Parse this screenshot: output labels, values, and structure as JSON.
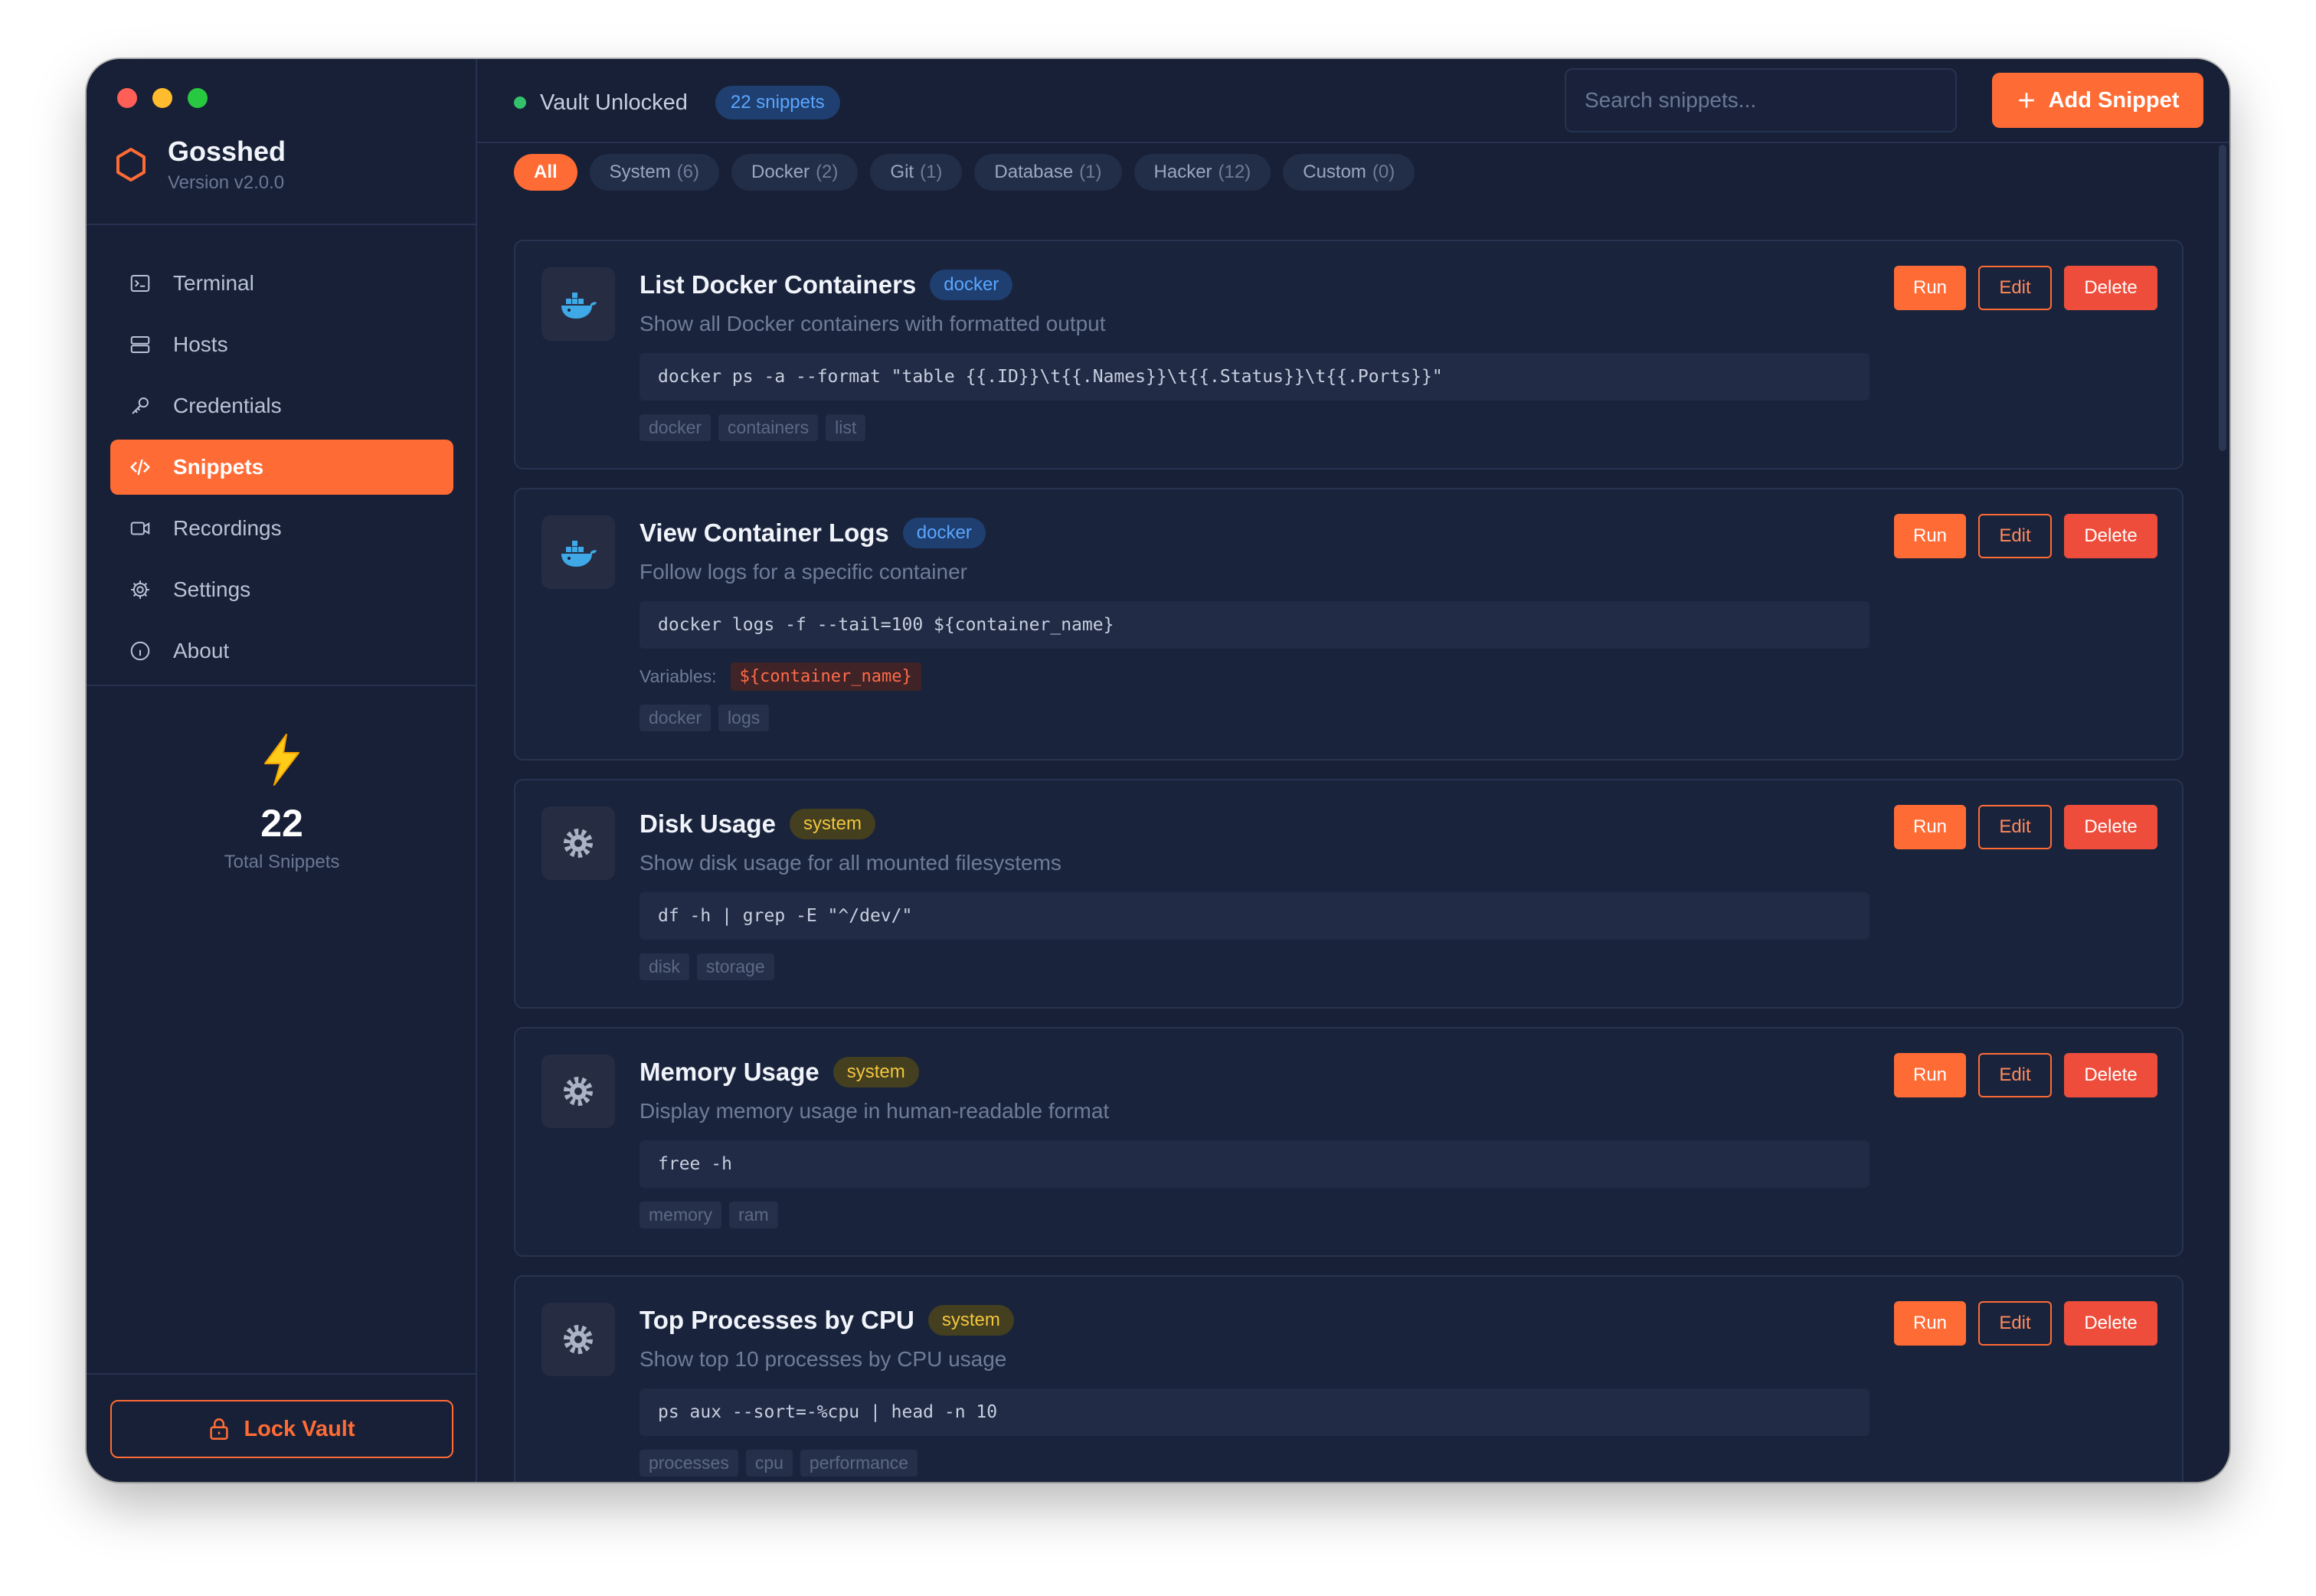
{
  "app": {
    "name": "Gosshed",
    "version": "Version v2.0.0"
  },
  "colors": {
    "accent": "#ff6b35",
    "background": "#172036",
    "success": "#33c26b",
    "danger": "#ee4d3b"
  },
  "nav": [
    {
      "label": "Terminal",
      "icon": "terminal-icon",
      "active": false
    },
    {
      "label": "Hosts",
      "icon": "server-icon",
      "active": false
    },
    {
      "label": "Credentials",
      "icon": "key-icon",
      "active": false
    },
    {
      "label": "Snippets",
      "icon": "code-icon",
      "active": true
    },
    {
      "label": "Recordings",
      "icon": "video-icon",
      "active": false
    },
    {
      "label": "Settings",
      "icon": "gear-icon",
      "active": false
    },
    {
      "label": "About",
      "icon": "info-icon",
      "active": false
    }
  ],
  "stats": {
    "icon": "lightning-icon",
    "value": "22",
    "label": "Total Snippets"
  },
  "lock_button": "Lock Vault",
  "header": {
    "status": "Vault Unlocked",
    "count_badge": "22 snippets",
    "search_placeholder": "Search snippets...",
    "add_button": "Add Snippet"
  },
  "filters": [
    {
      "label": "All",
      "count": "",
      "active": true
    },
    {
      "label": "System",
      "count": "(6)",
      "active": false
    },
    {
      "label": "Docker",
      "count": "(2)",
      "active": false
    },
    {
      "label": "Git",
      "count": "(1)",
      "active": false
    },
    {
      "label": "Database",
      "count": "(1)",
      "active": false
    },
    {
      "label": "Hacker",
      "count": "(12)",
      "active": false
    },
    {
      "label": "Custom",
      "count": "(0)",
      "active": false
    }
  ],
  "actions": {
    "run": "Run",
    "edit": "Edit",
    "delete": "Delete"
  },
  "variables_label": "Variables:",
  "snippets": [
    {
      "icon": "whale-icon",
      "title": "List Docker Containers",
      "category": "docker",
      "description": "Show all Docker containers with formatted output",
      "command": "docker ps -a --format \"table {{.ID}}\\t{{.Names}}\\t{{.Status}}\\t{{.Ports}}\"",
      "variables": [],
      "tags": [
        "docker",
        "containers",
        "list"
      ]
    },
    {
      "icon": "whale-icon",
      "title": "View Container Logs",
      "category": "docker",
      "description": "Follow logs for a specific container",
      "command": "docker logs -f --tail=100 ${container_name}",
      "variables": [
        "${container_name}"
      ],
      "tags": [
        "docker",
        "logs"
      ]
    },
    {
      "icon": "gear-icon",
      "title": "Disk Usage",
      "category": "system",
      "description": "Show disk usage for all mounted filesystems",
      "command": "df -h | grep -E \"^/dev/\"",
      "variables": [],
      "tags": [
        "disk",
        "storage"
      ]
    },
    {
      "icon": "gear-icon",
      "title": "Memory Usage",
      "category": "system",
      "description": "Display memory usage in human-readable format",
      "command": "free -h",
      "variables": [],
      "tags": [
        "memory",
        "ram"
      ]
    },
    {
      "icon": "gear-icon",
      "title": "Top Processes by CPU",
      "category": "system",
      "description": "Show top 10 processes by CPU usage",
      "command": "ps aux --sort=-%cpu | head -n 10",
      "variables": [],
      "tags": [
        "processes",
        "cpu",
        "performance"
      ]
    }
  ]
}
